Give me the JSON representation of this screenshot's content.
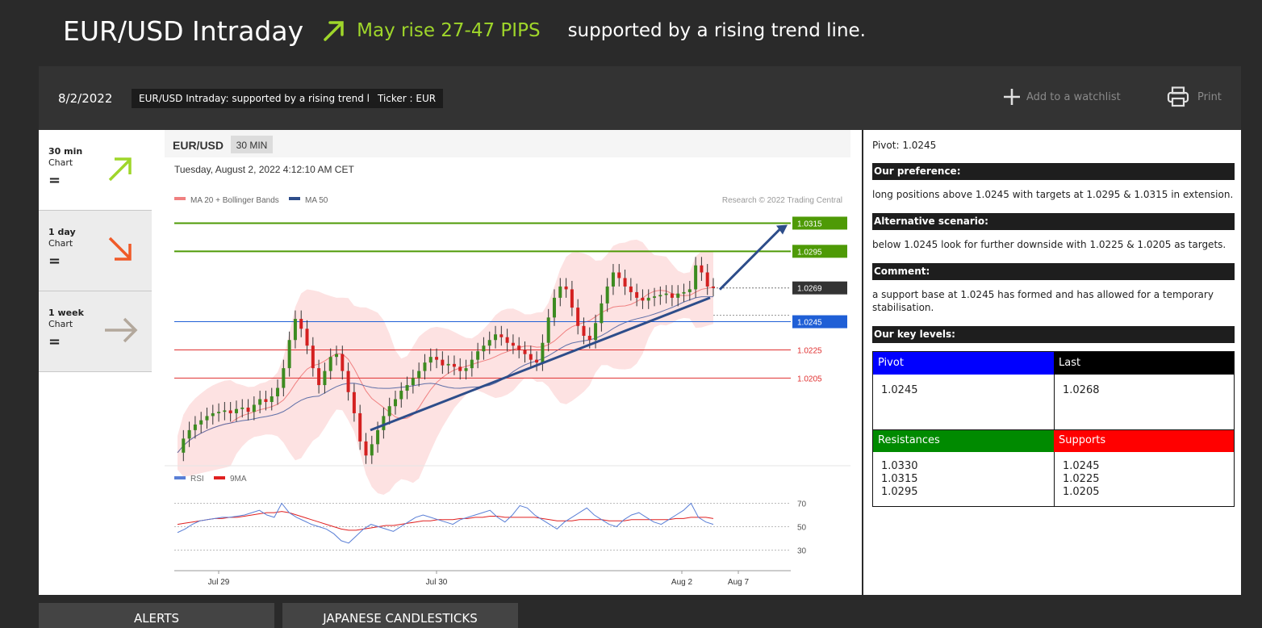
{
  "header": {
    "title": "EUR/USD Intraday",
    "rise_text": "May rise 27-47 PIPS",
    "subtitle": "supported by a rising trend line."
  },
  "toolbar": {
    "date": "8/2/2022",
    "tag_summary": "EUR/USD Intraday: supported by a rising trend line.",
    "tag_ticker": "Ticker : EUR",
    "watchlist_label": "Add to a watchlist",
    "print_label": "Print"
  },
  "timeframes": [
    {
      "name": "30 min",
      "sub": "Chart",
      "eq": "=",
      "icon": "arrow-up-right-icon",
      "color": "#9fd62a"
    },
    {
      "name": "1 day",
      "sub": "Chart",
      "eq": "=",
      "icon": "arrow-down-right-icon",
      "color": "#f05a28"
    },
    {
      "name": "1 week",
      "sub": "Chart",
      "eq": "=",
      "icon": "arrow-right-icon",
      "color": "#b3a89c"
    }
  ],
  "chart": {
    "symbol": "EUR/USD",
    "interval": "30 MIN",
    "timestamp": "Tuesday, August 2, 2022 4:12:10 AM CET",
    "legend_bb": "MA 20 + Bollinger Bands",
    "legend_ma50": "MA 50",
    "credit": "Research © 2022 Trading Central",
    "rsi_legend": "RSI",
    "rsi_ma_legend": "9MA",
    "rsi_ticks": [
      "70",
      "50",
      "30"
    ],
    "x_ticks": [
      "Jul 29",
      "Jul 30",
      "Aug 2",
      "Aug 7"
    ]
  },
  "chart_data": {
    "type": "line",
    "title": "EUR/USD",
    "xlabel": "",
    "ylabel": "",
    "levels": [
      {
        "label": "1.0315",
        "value": 1.0315,
        "kind": "resistance",
        "color": "#4e9a06"
      },
      {
        "label": "1.0295",
        "value": 1.0295,
        "kind": "resistance",
        "color": "#4e9a06"
      },
      {
        "label": "1.0269",
        "value": 1.0269,
        "kind": "last",
        "color": "#333333"
      },
      {
        "label": "1.0245",
        "value": 1.0245,
        "kind": "pivot",
        "color": "#1f5fd6"
      },
      {
        "label": "1.0225",
        "value": 1.0225,
        "kind": "support",
        "color": "#e03030"
      },
      {
        "label": "1.0205",
        "value": 1.0205,
        "kind": "support",
        "color": "#e03030"
      }
    ],
    "ylim": [
      1.0145,
      1.0325
    ],
    "series": [
      {
        "values": [
          1.0152,
          1.0162,
          1.0168,
          1.0172,
          1.0175,
          1.0178,
          1.018,
          1.0181,
          1.0182,
          1.018,
          1.0183,
          1.0184,
          1.0181,
          1.0186,
          1.019,
          1.0188,
          1.0192,
          1.0198,
          1.0212,
          1.0232,
          1.0247,
          1.024,
          1.0228,
          1.0212,
          1.02,
          1.021,
          1.022,
          1.0222,
          1.021,
          1.0195,
          1.018,
          1.016,
          1.015,
          1.0158,
          1.0168,
          1.0178,
          1.0185,
          1.019,
          1.0196,
          1.02,
          1.0205,
          1.021,
          1.0216,
          1.022,
          1.0218,
          1.0214,
          1.0215,
          1.0213,
          1.021,
          1.0212,
          1.0218,
          1.0224,
          1.0228,
          1.0232,
          1.0236,
          1.0234,
          1.023,
          1.0228,
          1.0225,
          1.0222,
          1.0218,
          1.0216,
          1.023,
          1.0248,
          1.0262,
          1.027,
          1.0268,
          1.0255,
          1.0242,
          1.0235,
          1.0232,
          1.0244,
          1.0258,
          1.027,
          1.028,
          1.0276,
          1.027,
          1.0266,
          1.0262,
          1.026,
          1.0262,
          1.0263,
          1.0264,
          1.0265,
          1.0262,
          1.0265,
          1.0266,
          1.0268,
          1.0285,
          1.028,
          1.027,
          1.0269
        ]
      }
    ],
    "rsi": [
      45,
      48,
      52,
      55,
      56,
      57,
      58,
      58,
      59,
      60,
      62,
      64,
      60,
      58,
      70,
      62,
      58,
      55,
      52,
      50,
      48,
      44,
      38,
      36,
      42,
      48,
      52,
      50,
      48,
      46,
      50,
      54,
      58,
      60,
      58,
      56,
      54,
      52,
      56,
      58,
      60,
      62,
      64,
      58,
      54,
      60,
      68,
      66,
      60,
      56,
      52,
      48,
      54,
      58,
      62,
      66,
      60,
      56,
      52,
      50,
      56,
      60,
      62,
      58,
      54,
      52,
      56,
      60,
      64,
      70,
      58,
      54,
      52
    ],
    "rsi_ma": [
      52,
      53,
      54,
      55,
      56,
      57,
      57,
      58,
      58,
      59,
      60,
      61,
      62,
      62,
      63,
      62,
      60,
      58,
      56,
      54,
      52,
      50,
      48,
      47,
      47,
      48,
      49,
      50,
      51,
      51,
      52,
      53,
      54,
      55,
      55,
      56,
      56,
      56,
      57,
      57,
      58,
      58,
      59,
      59,
      58,
      58,
      58,
      58,
      58,
      57,
      56,
      55,
      55,
      55,
      56,
      56,
      56,
      56,
      55,
      55,
      55,
      56,
      56,
      56,
      56,
      56,
      56,
      57,
      57,
      58,
      58,
      58,
      57
    ]
  },
  "panel": {
    "pivot_text": "Pivot: 1.0245",
    "pref_head": "Our preference:",
    "pref_text": "long positions above 1.0245 with targets at 1.0295 & 1.0315 in extension.",
    "alt_head": "Alternative scenario:",
    "alt_text": "below 1.0245 look for further downside with 1.0225 & 1.0205 as targets.",
    "comment_head": "Comment:",
    "comment_text": "a support base at 1.0245 has formed and has allowed for a temporary stabilisation.",
    "key_head": "Our key levels:",
    "pivot_head": "Pivot",
    "pivot_val": "1.0245",
    "last_head": "Last",
    "last_val": "1.0268",
    "res_head": "Resistances",
    "res_vals": [
      "1.0330",
      "1.0315",
      "1.0295"
    ],
    "sup_head": "Supports",
    "sup_vals": [
      "1.0245",
      "1.0225",
      "1.0205"
    ]
  },
  "tabs": {
    "alerts": "ALERTS",
    "candles": "JAPANESE CANDLESTICKS"
  }
}
